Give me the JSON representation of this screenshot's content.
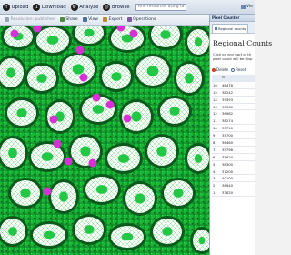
{
  "toolbar": {
    "upload_label": "Upload",
    "download_label": "Download",
    "analyze_label": "Analyze",
    "browse_label": "Browse",
    "search_placeholder": "Find resources using tags",
    "right_label": "Vie"
  },
  "secondary_toolbar": {
    "item1": "Resolution: published",
    "item2": "Share",
    "item3": "View",
    "item4": "Expert",
    "item5": "Operations"
  },
  "panel": {
    "header": "Pixel Counter",
    "tab_label": "Regional counts",
    "title": "Regional Counts",
    "description_line1": "Click on any part of th",
    "description_line2": "pixel count will be disp",
    "delete_label": "Delete",
    "reset_label": "Reset",
    "table_header": "N",
    "rows": [
      {
        "idx": "16",
        "value": "46478"
      },
      {
        "idx": "15",
        "value": "38242"
      },
      {
        "idx": "14",
        "value": "39393"
      },
      {
        "idx": "13",
        "value": "35560"
      },
      {
        "idx": "12",
        "value": "36982"
      },
      {
        "idx": "11",
        "value": "38274"
      },
      {
        "idx": "10",
        "value": "35790"
      },
      {
        "idx": "9",
        "value": "35700"
      },
      {
        "idx": "8",
        "value": "36460"
      },
      {
        "idx": "7",
        "value": "35798"
      },
      {
        "idx": "6",
        "value": "35620"
      },
      {
        "idx": "5",
        "value": "38300"
      },
      {
        "idx": "4",
        "value": "37200"
      },
      {
        "idx": "3",
        "value": "40100"
      },
      {
        "idx": "2",
        "value": "36940"
      },
      {
        "idx": "1",
        "value": "33820"
      }
    ]
  },
  "colors": {
    "tissue_green": "#19c53a",
    "lumen_white": "#ffffff",
    "background_dark": "#0c2f14",
    "marker_magenta": "#d631d6"
  },
  "icons": [
    "upload-icon",
    "download-icon",
    "analyze-icon",
    "browse-icon",
    "delete-icon",
    "reset-icon"
  ]
}
